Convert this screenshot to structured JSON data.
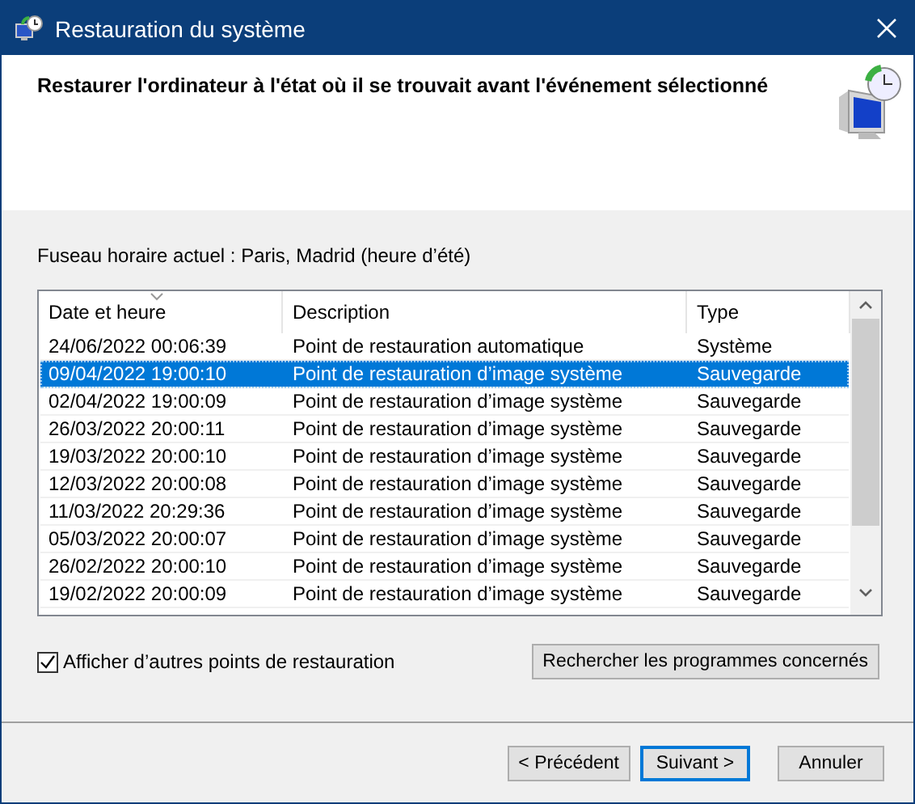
{
  "window": {
    "title": "Restauration du système"
  },
  "header": {
    "heading": "Restaurer l'ordinateur à l'état où il se trouvait avant l'événement sélectionné"
  },
  "timezone": "Fuseau horaire actuel : Paris, Madrid (heure d’été)",
  "table": {
    "columns": [
      "Date et heure",
      "Description",
      "Type"
    ],
    "rows": [
      {
        "cells": [
          "24/06/2022 00:06:39",
          "Point de restauration automatique",
          "Système"
        ],
        "selected": false
      },
      {
        "cells": [
          "09/04/2022 19:00:10",
          "Point de restauration d’image système",
          "Sauvegarde"
        ],
        "selected": true
      },
      {
        "cells": [
          "02/04/2022 19:00:09",
          "Point de restauration d’image système",
          "Sauvegarde"
        ],
        "selected": false
      },
      {
        "cells": [
          "26/03/2022 20:00:11",
          "Point de restauration d’image système",
          "Sauvegarde"
        ],
        "selected": false
      },
      {
        "cells": [
          "19/03/2022 20:00:10",
          "Point de restauration d’image système",
          "Sauvegarde"
        ],
        "selected": false
      },
      {
        "cells": [
          "12/03/2022 20:00:08",
          "Point de restauration d’image système",
          "Sauvegarde"
        ],
        "selected": false
      },
      {
        "cells": [
          "11/03/2022 20:29:36",
          "Point de restauration d’image système",
          "Sauvegarde"
        ],
        "selected": false
      },
      {
        "cells": [
          "05/03/2022 20:00:07",
          "Point de restauration d’image système",
          "Sauvegarde"
        ],
        "selected": false
      },
      {
        "cells": [
          "26/02/2022 20:00:10",
          "Point de restauration d’image système",
          "Sauvegarde"
        ],
        "selected": false
      },
      {
        "cells": [
          "19/02/2022 20:00:09",
          "Point de restauration d’image système",
          "Sauvegarde"
        ],
        "selected": false
      }
    ]
  },
  "show_more": {
    "label": "Afficher d’autres points de restauration",
    "checked": true
  },
  "scan_button": "Rechercher les programmes concernés",
  "buttons": [
    {
      "label": "< Précédent",
      "default": false
    },
    {
      "label": "Suivant >",
      "default": true
    },
    {
      "label": "Annuler",
      "default": false
    }
  ]
}
